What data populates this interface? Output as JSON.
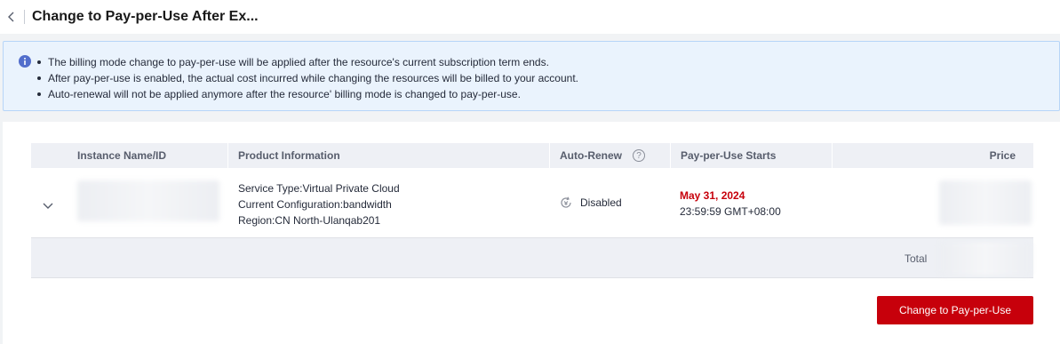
{
  "header": {
    "title": "Change to Pay-per-Use After Ex..."
  },
  "alert": {
    "items": [
      "The billing mode change to pay-per-use will be applied after the resource's current subscription term ends.",
      "After pay-per-use is enabled, the actual cost incurred while changing the resources will be billed to your account.",
      "Auto-renewal will not be applied anymore after the resource' billing mode is changed to pay-per-use."
    ]
  },
  "table": {
    "columns": {
      "instance": "Instance Name/ID",
      "product": "Product Information",
      "autorenew": "Auto-Renew",
      "starts": "Pay-per-Use Starts",
      "price": "Price"
    },
    "rows": [
      {
        "product": {
          "service_type": "Service Type:Virtual Private Cloud",
          "configuration": "Current Configuration:bandwidth",
          "region": "Region:CN North-Ulanqab201"
        },
        "autorenew": "Disabled",
        "starts_date": "May 31, 2024",
        "starts_time": "23:59:59 GMT+08:00"
      }
    ],
    "total_label": "Total"
  },
  "actions": {
    "submit_label": "Change to Pay-per-Use"
  },
  "colors": {
    "accent": "#c7000b",
    "info": "#526ecc"
  }
}
